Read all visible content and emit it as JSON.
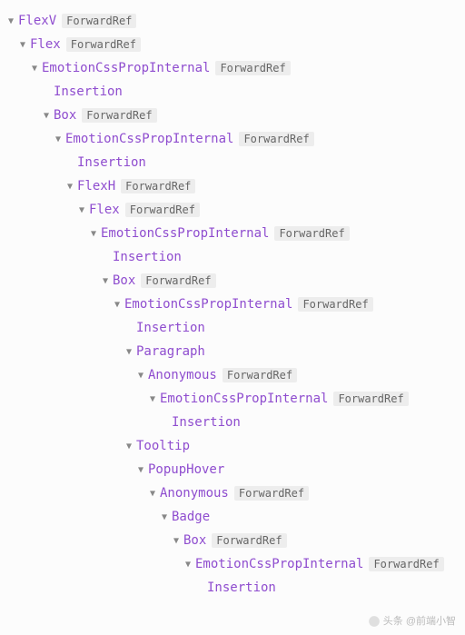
{
  "badges": {
    "forwardRef": "ForwardRef"
  },
  "watermark": {
    "prefix": "头条",
    "site": "@前端小智"
  },
  "tree": [
    {
      "depth": 0,
      "arrow": "expanded",
      "label": "FlexV",
      "badge": true
    },
    {
      "depth": 1,
      "arrow": "expanded",
      "label": "Flex",
      "badge": true
    },
    {
      "depth": 2,
      "arrow": "expanded",
      "label": "EmotionCssPropInternal",
      "badge": true
    },
    {
      "depth": 3,
      "arrow": "none",
      "label": "Insertion",
      "badge": false
    },
    {
      "depth": 3,
      "arrow": "expanded",
      "label": "Box",
      "badge": true
    },
    {
      "depth": 4,
      "arrow": "expanded",
      "label": "EmotionCssPropInternal",
      "badge": true
    },
    {
      "depth": 5,
      "arrow": "none",
      "label": "Insertion",
      "badge": false
    },
    {
      "depth": 5,
      "arrow": "expanded",
      "label": "FlexH",
      "badge": true
    },
    {
      "depth": 6,
      "arrow": "expanded",
      "label": "Flex",
      "badge": true
    },
    {
      "depth": 7,
      "arrow": "expanded",
      "label": "EmotionCssPropInternal",
      "badge": true
    },
    {
      "depth": 8,
      "arrow": "none",
      "label": "Insertion",
      "badge": false
    },
    {
      "depth": 8,
      "arrow": "expanded",
      "label": "Box",
      "badge": true
    },
    {
      "depth": 9,
      "arrow": "expanded",
      "label": "EmotionCssPropInternal",
      "badge": true
    },
    {
      "depth": 10,
      "arrow": "none",
      "label": "Insertion",
      "badge": false
    },
    {
      "depth": 10,
      "arrow": "expanded",
      "label": "Paragraph",
      "badge": false
    },
    {
      "depth": 11,
      "arrow": "expanded",
      "label": "Anonymous",
      "badge": true
    },
    {
      "depth": 12,
      "arrow": "expanded",
      "label": "EmotionCssPropInternal",
      "badge": true
    },
    {
      "depth": 13,
      "arrow": "none",
      "label": "Insertion",
      "badge": false
    },
    {
      "depth": 10,
      "arrow": "expanded",
      "label": "Tooltip",
      "badge": false
    },
    {
      "depth": 11,
      "arrow": "expanded",
      "label": "PopupHover",
      "badge": false
    },
    {
      "depth": 12,
      "arrow": "expanded",
      "label": "Anonymous",
      "badge": true
    },
    {
      "depth": 13,
      "arrow": "expanded",
      "label": "Badge",
      "badge": false
    },
    {
      "depth": 14,
      "arrow": "expanded",
      "label": "Box",
      "badge": true
    },
    {
      "depth": 15,
      "arrow": "expanded",
      "label": "EmotionCssPropInternal",
      "badge": true
    },
    {
      "depth": 16,
      "arrow": "none",
      "label": "Insertion",
      "badge": false
    }
  ]
}
